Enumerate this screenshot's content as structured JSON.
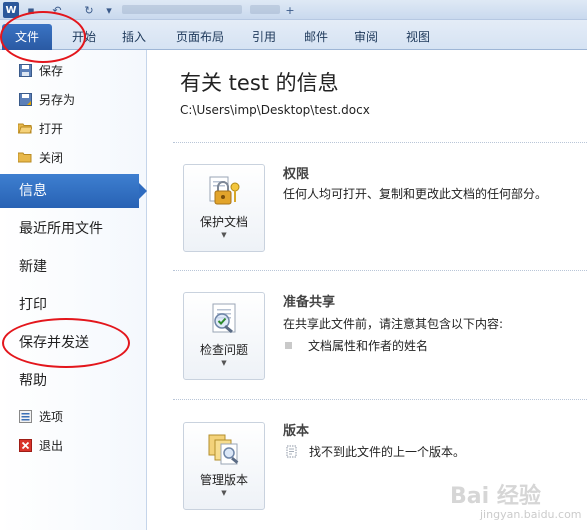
{
  "titlebar": {
    "logo": "W",
    "save_glyph": "▪",
    "undo_glyph": "↶",
    "redo_glyph": "↻",
    "customize_glyph": "▾",
    "new_tab_glyph": "+"
  },
  "ribbon": {
    "tabs": [
      "文件",
      "开始",
      "插入",
      "页面布局",
      "引用",
      "邮件",
      "审阅",
      "视图"
    ]
  },
  "nav": {
    "small_items_top": [
      {
        "label": "保存",
        "icon": "save-icon"
      },
      {
        "label": "另存为",
        "icon": "save-as-icon"
      },
      {
        "label": "打开",
        "icon": "open-folder-icon"
      },
      {
        "label": "关闭",
        "icon": "close-folder-icon"
      }
    ],
    "big_items": [
      "信息",
      "最近所用文件",
      "新建",
      "打印",
      "保存并发送",
      "帮助"
    ],
    "active_item": "信息",
    "small_items_bottom": [
      {
        "label": "选项",
        "icon": "options-icon"
      },
      {
        "label": "退出",
        "icon": "exit-icon"
      }
    ]
  },
  "main": {
    "title": "有关 test 的信息",
    "path": "C:\\Users\\imp\\Desktop\\test.docx",
    "sections": [
      {
        "button": "保护文档",
        "title": "权限",
        "desc": "任何人均可打开、复制和更改此文档的任何部分。",
        "items": [],
        "icon": "protect-lock-key-icon"
      },
      {
        "button": "检查问题",
        "title": "准备共享",
        "desc": "在共享此文件前，请注意其包含以下内容:",
        "items": [
          "文档属性和作者的姓名"
        ],
        "icon": "check-document-icon"
      },
      {
        "button": "管理版本",
        "title": "版本",
        "desc": "",
        "items": [
          "找不到此文件的上一个版本。"
        ],
        "icon": "manage-versions-icon"
      }
    ]
  },
  "watermark": {
    "text": "Bai 经验",
    "sub": "jingyan.baidu.com"
  },
  "colors": {
    "accent": "#2b63b5",
    "annotation": "#e3161c"
  }
}
